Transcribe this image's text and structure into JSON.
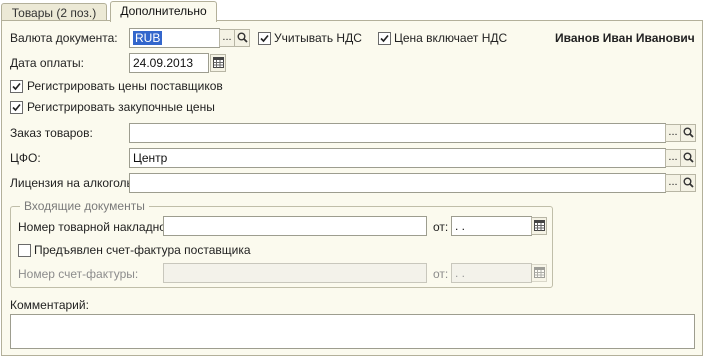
{
  "tabs": [
    {
      "label": "Товары (2 поз.)",
      "active": false
    },
    {
      "label": "Дополнительно",
      "active": true
    }
  ],
  "currency": {
    "label": "Валюта документа:",
    "value": "RUB",
    "select_button": "..."
  },
  "vat": {
    "label": "Учитывать НДС",
    "checked": true
  },
  "price_includes_vat": {
    "label": "Цена включает НДС",
    "checked": true
  },
  "user_name": "Иванов Иван Иванович",
  "payment_date": {
    "label": "Дата оплаты:",
    "value": "24.09.2013"
  },
  "register_supplier_prices": {
    "label": "Регистрировать цены поставщиков",
    "checked": true
  },
  "register_purchase_prices": {
    "label": "Регистрировать закупочные цены",
    "checked": true
  },
  "goods_order": {
    "label": "Заказ товаров:",
    "value": "",
    "select_button": "..."
  },
  "cfo": {
    "label": "ЦФО:",
    "value": "Центр",
    "select_button": "..."
  },
  "alcohol_license": {
    "label": "Лицензия на алкоголь:",
    "value": "",
    "select_button": "..."
  },
  "incoming_docs": {
    "title": "Входящие документы",
    "invoice_number_label": "Номер товарной накладной:",
    "invoice_number_value": "",
    "from_label": "от:",
    "invoice_date_value": " .  .",
    "vat_invoice_checkbox": {
      "label": "Предъявлен счет-фактура поставщика",
      "checked": false
    },
    "vat_invoice_number_label": "Номер счет-фактуры:",
    "vat_invoice_number_value": "",
    "vat_invoice_from_label": "от:",
    "vat_invoice_date_value": " .  ."
  },
  "comment": {
    "label": "Комментарий:",
    "value": ""
  },
  "icons": {
    "select": "ellipsis",
    "search": "magnifier-icon",
    "calendar": "calendar-icon",
    "checkmark": "checkmark-icon"
  },
  "colors": {
    "panel_bg": "#fbfaee",
    "tab_bg": "#ece9d6",
    "border": "#b3b09a",
    "selection": "#3366cc"
  }
}
